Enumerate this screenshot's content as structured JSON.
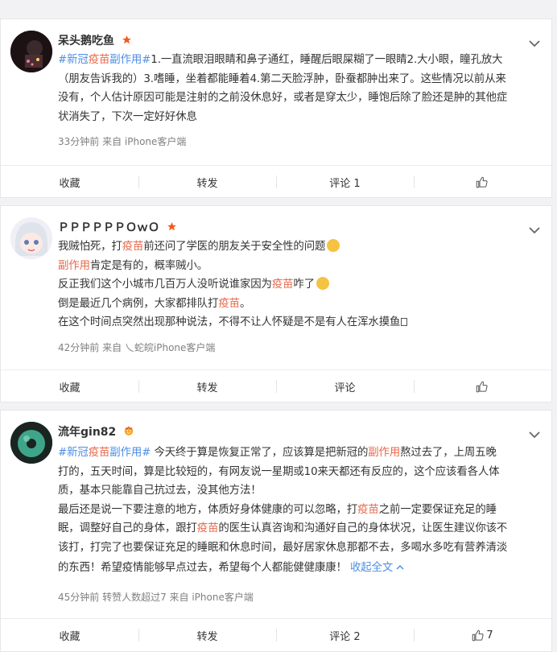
{
  "posts": [
    {
      "user": "呆头鹅吃鱼",
      "badge": "star-badge",
      "lines": [
        {
          "tag": "#新冠",
          "kw": "疫苗",
          "tag2": "副作用#",
          "rest": "1.一直流眼泪眼睛和鼻子通红，睡醒后眼屎糊了一眼睛2.大小眼，瞳孔放大"
        },
        {
          "text": "（朋友告诉我的）3.嗜睡，坐着都能睡着4.第二天脸浮肿，卧蚕都肿出来了。这些情况以前从来"
        },
        {
          "text": "没有，个人估计原因可能是注射的之前没休息好，或者是穿太少，睡饱后除了脸还是肿的其他症"
        },
        {
          "text": "状消失了，下次一定好好休息"
        }
      ],
      "meta": "33分钟前  来自 iPhone客户端",
      "actions": {
        "collect": "收藏",
        "repost": "转发",
        "comment": "评论 1",
        "like": ""
      }
    },
    {
      "user": "ＰＰＰＰＰＰＯｗＯ",
      "badge": "star-badge",
      "lines": [
        {
          "a": "我贼怕死，打",
          "kw": "疫苗",
          "b": "前还问了学医的朋友关于安全性的问题"
        },
        {
          "kw": "副作用",
          "b": "肯定是有的，概率贼小。"
        },
        {
          "a": "反正我们这个小城市几百万人没听说谁家因为",
          "kw": "疫苗",
          "b": "咋了"
        },
        {
          "a": "倒是最近几个病例，大家都排队打",
          "kw": "疫苗",
          "b": "。"
        },
        {
          "a": "在这个时间点突然出现那种说法，不得不让人怀疑是不是有人在浑水摸鱼"
        }
      ],
      "meta": "42分钟前  来自 乀蛇皖iPhone客户端",
      "actions": {
        "collect": "收藏",
        "repost": "转发",
        "comment": "评论",
        "like": ""
      }
    },
    {
      "user": "流年gin82",
      "badge": "crown-badge",
      "lines": [
        {
          "tag": "#新冠",
          "kw": "疫苗",
          "tag2": "副作用#",
          "a": " 今天终于算是恢复正常了，应该算是把新冠的",
          "kw2": "副作用",
          "b": "熬过去了，上周五晚"
        },
        {
          "text": "打的，五天时间，算是比较短的，有网友说一星期或10来天都还有反应的，这个应该看各人体"
        },
        {
          "text": "质，基本只能靠自己抗过去，没其他方法！"
        },
        {
          "a": "最后还是说一下要注意的地方，体质好身体健康的可以忽略，打",
          "kw": "疫苗",
          "b": "之前一定要保证充足的睡"
        },
        {
          "text": "眠，调整好自己的身体，跟打"
        },
        {
          "text": "该打，打完了也要保证充足的睡眠和休息时间，最好居家休息那都不去，多喝水多吃有营养清淡"
        },
        {
          "a": "的东西！希望疫情能够早点过去，希望每个人都能健健康康！ ",
          "more": "收起全文"
        }
      ],
      "line5_kw": "疫苗",
      "line5_b": "的医生认真咨询和沟通好自己的身体状况，让医生建议你该不",
      "meta": "45分钟前 转赞人数超过7  来自 iPhone客户端",
      "actions": {
        "collect": "收藏",
        "repost": "转发",
        "comment": "评论 2",
        "like": "7"
      }
    }
  ],
  "colors": {
    "tag": "#4c8ee6",
    "keyword": "#e86a4c",
    "star": "#f45a1e"
  }
}
